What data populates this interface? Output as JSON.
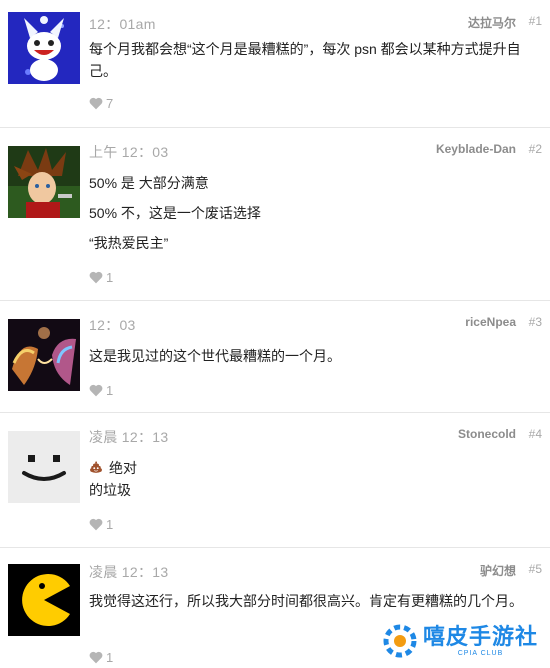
{
  "comments": [
    {
      "time": "12：01am",
      "author": "达拉马尔",
      "number": "#1",
      "lines": [
        "每个月我都会想“这个月是最糟糕的”，每次 psn 都会以某种方式提升自己。"
      ],
      "likes": "7",
      "avatar_icon": "jack-frost-mascot-avatar"
    },
    {
      "time": "上午 12：03",
      "author": "Keyblade-Dan",
      "number": "#2",
      "lines": [
        "50% 是 大部分满意",
        "50% 不，这是一个废话选择",
        "“我热爱民主”"
      ],
      "likes": "1",
      "avatar_icon": "spiky-hair-character-avatar"
    },
    {
      "time": "12：03",
      "author": "riceNpea",
      "number": "#3",
      "lines": [
        "这是我见过的这个世代最糟糕的一个月。"
      ],
      "likes": "1",
      "avatar_icon": "colorful-faces-art-avatar"
    },
    {
      "time": "凌晨 12：13",
      "author": "Stonecold",
      "number": "#4",
      "lines": [
        "绝对",
        "的垃圾"
      ],
      "emoji_icon": "pile-of-poo-icon",
      "likes": "1",
      "avatar_icon": "simple-smiley-face-avatar"
    },
    {
      "time": "凌晨 12：13",
      "author": "驴幻想",
      "number": "#5",
      "lines": [
        "我觉得这还行，所以我大部分时间都很高兴。肯定有更糟糕的几个月。"
      ],
      "likes": "1",
      "avatar_icon": "pacman-avatar"
    }
  ],
  "watermark": {
    "main": "嘻皮手游社",
    "sub": "CPIA CLUB",
    "color": "#1e88e5"
  },
  "colors": {
    "meta_gray": "#a8a8a8",
    "author_gray": "#8c8c8c",
    "divider": "#e6e6e6",
    "text": "#222222"
  }
}
